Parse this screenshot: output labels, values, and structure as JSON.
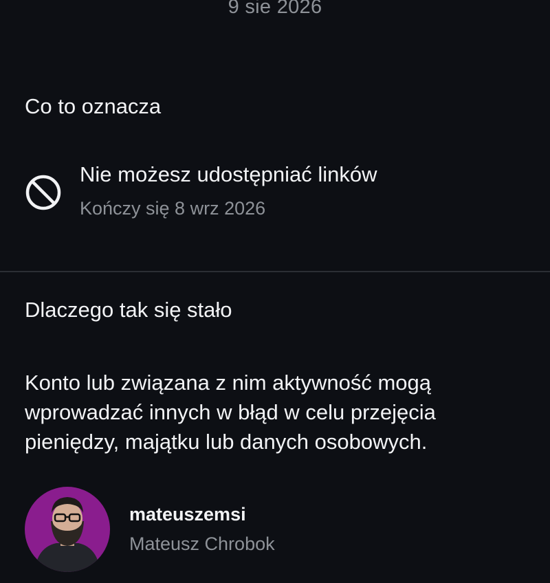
{
  "header": {
    "date": "9 sie 2026"
  },
  "what_it_means": {
    "title": "Co to oznacza",
    "restriction": {
      "icon": "block-icon",
      "title": "Nie możesz udostępniać linków",
      "subtitle": "Kończy się 8 wrz 2026"
    }
  },
  "why": {
    "title": "Dlaczego tak się stało",
    "description": "Konto lub związana z nim aktywność mogą wprowadzać innych w błąd w celu przejęcia pieniędzy, majątku lub danych osobowych."
  },
  "profile": {
    "handle": "mateuszemsi",
    "name": "Mateusz Chrobok",
    "avatar_bg": "#8a1d8e"
  }
}
